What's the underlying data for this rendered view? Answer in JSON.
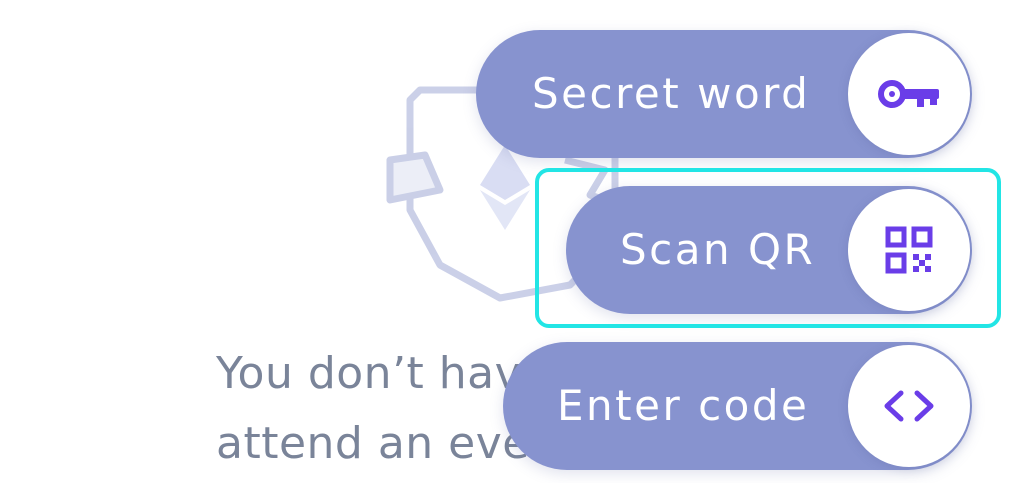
{
  "background": {
    "text_line_1": "You don’t hav",
    "text_line_2": "attend an even"
  },
  "actions": [
    {
      "label": "Secret word",
      "icon": "key-icon"
    },
    {
      "label": "Scan QR",
      "icon": "qr-code-icon",
      "focused": true
    },
    {
      "label": "Enter code",
      "icon": "code-brackets-icon"
    }
  ],
  "colors": {
    "pill": "#8793cf",
    "icon": "#6a3de8",
    "focus_ring": "#22e5e5",
    "background_text": "#7a8499"
  }
}
